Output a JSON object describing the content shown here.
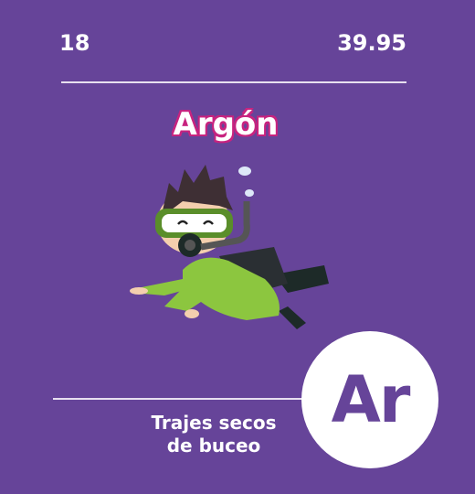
{
  "element": {
    "atomic_number": "18",
    "atomic_mass": "39.95",
    "name": "Argón",
    "symbol": "Ar",
    "use_line1": "Trajes secos",
    "use_line2": "de buceo"
  },
  "colors": {
    "background": "#664499",
    "title_outline": "#c8237f",
    "text": "#ffffff",
    "suit": "#8cc63f"
  },
  "illustration": "scuba-diver"
}
